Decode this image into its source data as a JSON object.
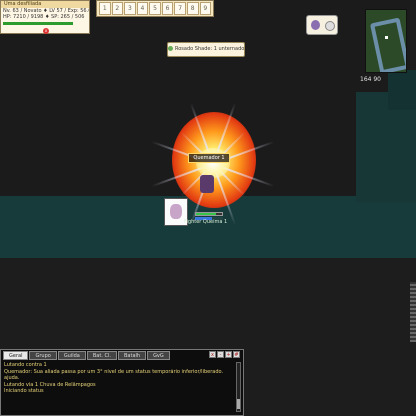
{
  "status": {
    "title": "Uma desfiliada",
    "line1": "Nv. 63 / Novato ♦ LV 57 / Exp: 56.6 %",
    "line2": "HP: 7210 / 9198 ♦ SP: 265 / 506",
    "hp_fraction": 1.0
  },
  "hotbar": {
    "slots": [
      "1",
      "2",
      "3",
      "4",
      "5",
      "6",
      "7",
      "8",
      "9"
    ]
  },
  "minimap": {
    "coords": "164 90"
  },
  "announcement": {
    "text": "Rosado Shade: 1 unternado"
  },
  "character": {
    "nametag": "Quemador 1",
    "name": "Fighter Queima 1",
    "hp_fraction": 0.75,
    "sp_fraction": 0.6
  },
  "chat": {
    "tabs": [
      "Geral",
      "Grupo",
      "Guilda",
      "Bat. Cl.",
      "Batalh",
      "GvG"
    ],
    "active_tab": 0,
    "buttons": [
      "x",
      "-",
      "+",
      "#"
    ],
    "messages": [
      "Lutando contra 1",
      "Quemador: Sua aliada passa por um 3° nível de um status temporário inferior/liberado.",
      "ajuda.",
      "Lutando via 1 Chuva de Relâmpagos",
      "Iniciando status"
    ]
  }
}
